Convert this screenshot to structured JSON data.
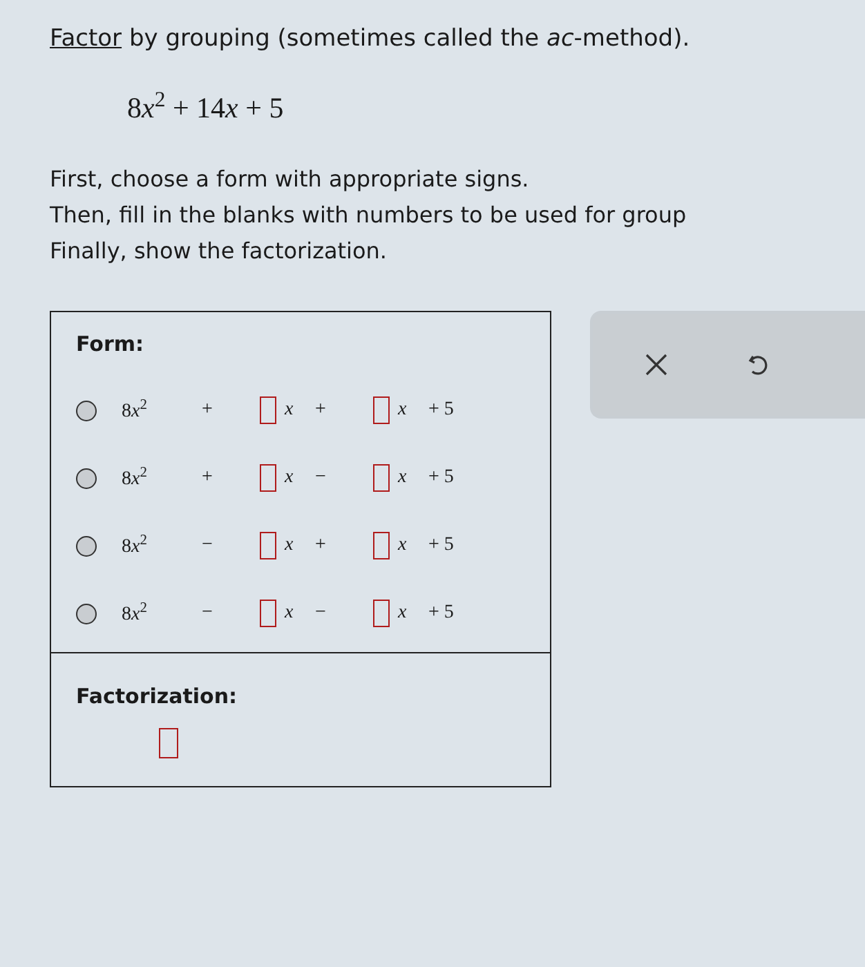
{
  "intro": {
    "link": "Factor",
    "rest": " by grouping (sometimes called the *ac*-method)."
  },
  "expression": [
    {
      "coef": "8",
      "var": "x",
      "exp": "2"
    },
    {
      "op": "+"
    },
    {
      "coef": "14",
      "var": "x"
    },
    {
      "op": "+"
    },
    {
      "coef": "5"
    }
  ],
  "instructions": [
    "First, choose a form with appropriate signs.",
    "Then, fill in the blanks with numbers to be used for group",
    "Finally, show the factorization."
  ],
  "form": {
    "label": "Form:",
    "options": [
      {
        "selected": false,
        "lead": {
          "coef": "8",
          "var": "x",
          "exp": "2"
        },
        "op1": "+",
        "var1": "x",
        "op2": "+",
        "var2": "x",
        "tail": "+ 5"
      },
      {
        "selected": false,
        "lead": {
          "coef": "8",
          "var": "x",
          "exp": "2"
        },
        "op1": "+",
        "var1": "x",
        "op2": "−",
        "var2": "x",
        "tail": "+ 5"
      },
      {
        "selected": false,
        "lead": {
          "coef": "8",
          "var": "x",
          "exp": "2"
        },
        "op1": "−",
        "var1": "x",
        "op2": "+",
        "var2": "x",
        "tail": "+ 5"
      },
      {
        "selected": false,
        "lead": {
          "coef": "8",
          "var": "x",
          "exp": "2"
        },
        "op1": "−",
        "var1": "x",
        "op2": "−",
        "var2": "x",
        "tail": "+ 5"
      }
    ]
  },
  "factorization": {
    "label": "Factorization:"
  },
  "tools": [
    {
      "kind": "clear"
    },
    {
      "kind": "undo"
    }
  ]
}
